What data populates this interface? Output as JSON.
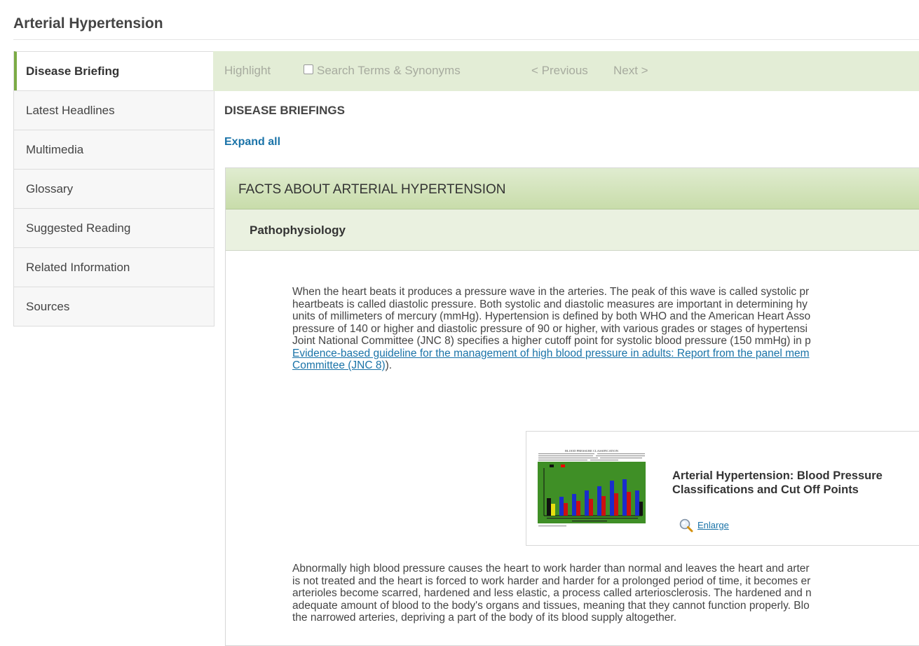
{
  "page_title": "Arterial Hypertension",
  "sidebar": {
    "items": [
      {
        "label": "Disease Briefing",
        "active": true
      },
      {
        "label": "Latest Headlines"
      },
      {
        "label": "Multimedia"
      },
      {
        "label": "Glossary"
      },
      {
        "label": "Suggested Reading"
      },
      {
        "label": "Related Information"
      },
      {
        "label": "Sources"
      }
    ]
  },
  "toolbar": {
    "highlight": "Highlight",
    "search_terms": "Search Terms & Synonyms",
    "previous": "< Previous",
    "next": "Next >"
  },
  "main": {
    "heading": "DISEASE BRIEFINGS",
    "expand_all": "Expand all",
    "section_title": "FACTS ABOUT ARTERIAL HYPERTENSION",
    "subsection_title": "Pathophysiology",
    "paragraph1": {
      "lines": [
        "When the heart beats it produces a pressure wave in the arteries. The peak of this wave is called systolic pr",
        "heartbeats is called diastolic pressure. Both systolic and diastolic measures are important in determining hy",
        "units of millimeters of mercury (mmHg). Hypertension is defined by both WHO and the American Heart Asso",
        "pressure of 140 or higher and diastolic pressure of 90 or higher, with various grades or stages of hypertensi",
        "Joint National Committee (JNC 8) specifies a higher cutoff point for systolic blood pressure (150 mmHg) in p"
      ],
      "link_line1": "Evidence-based guideline for the management of high blood pressure in adults: Report from the panel mem",
      "link_line2": "Committee (JNC 8)",
      "link_suffix": ")."
    },
    "figure": {
      "title": "Arterial Hypertension: Blood Pressure Classifications and Cut Off Points",
      "enlarge": "Enlarge",
      "thumbnail_title": "BLOOD PRESSURE CLASSIFICATION"
    },
    "paragraph2": {
      "lines": [
        "Abnormally high blood pressure causes the heart to work harder than normal and leaves the heart and arter",
        "is not treated and the heart is forced to work harder and harder for a prolonged period of time, it becomes er",
        "arterioles become scarred, hardened and less elastic, a process called arteriosclerosis. The hardened and n",
        "adequate amount of blood to the body's organs and tissues, meaning that they cannot function properly. Blo",
        "the narrowed arteries, depriving a part of the body of its blood supply altogether."
      ]
    }
  },
  "colors": {
    "accent_green": "#7bab45",
    "toolbar_bg": "#e3edd6",
    "link_blue": "#1a73a8"
  },
  "icons": {
    "search_terms_checkbox": "checkbox-unchecked",
    "enlarge": "magnifier-icon"
  }
}
